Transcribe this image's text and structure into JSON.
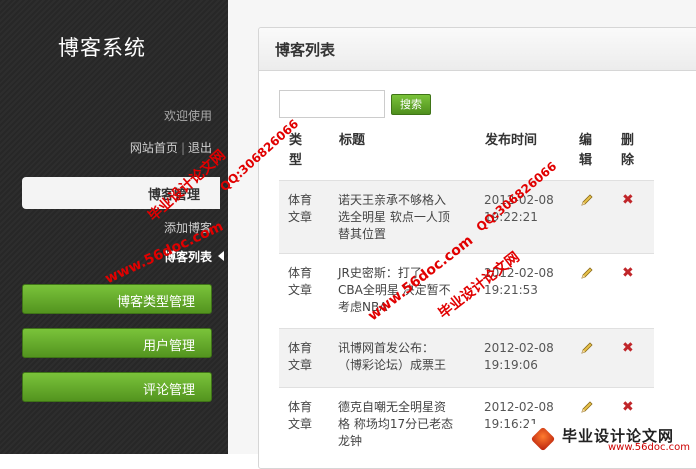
{
  "sidebar": {
    "app_title": "博客系统",
    "welcome": "欢迎使用",
    "links": {
      "home": "网站首页",
      "separator": "|",
      "logout": "退出"
    },
    "active_section": "博客管理",
    "sub_items": [
      "添加博客",
      "博客列表"
    ],
    "nav_buttons": [
      "博客类型管理",
      "用户管理",
      "评论管理"
    ]
  },
  "panel": {
    "title": "博客列表",
    "search_button": "搜索",
    "search_value": "",
    "columns": {
      "type": [
        "类",
        "型"
      ],
      "title": "标题",
      "date": "发布时间",
      "edit": [
        "编",
        "辑"
      ],
      "delete": [
        "删",
        "除"
      ]
    },
    "rows": [
      {
        "type": [
          "体育",
          "文章"
        ],
        "title": [
          "诺天王亲承不够格入",
          "选全明星 软点一人顶",
          "替其位置"
        ],
        "date": [
          "2012-02-08",
          "19:22:21"
        ]
      },
      {
        "type": [
          "体育",
          "文章"
        ],
        "title": [
          "JR史密斯：打了",
          "CBA全明星 决定暂不",
          "考虑NBA"
        ],
        "date": [
          "2012-02-08",
          "19:21:53"
        ]
      },
      {
        "type": [
          "体育",
          "文章"
        ],
        "title": [
          "讯博网首发公布：",
          "（博彩论坛）成票王"
        ],
        "date": [
          "2012-02-08",
          "19:19:06"
        ]
      },
      {
        "type": [
          "体育",
          "文章"
        ],
        "title": [
          "德克自嘲无全明星资",
          "格 称场均17分已老态",
          "龙钟"
        ],
        "date": [
          "2012-02-08",
          "19:16:21"
        ]
      }
    ]
  },
  "watermark": {
    "cn": "毕业设计论文网",
    "qq": "QQ:306826066",
    "url": "www.56doc.com",
    "logo_text": "毕业设计论文网",
    "logo_url": "www.56doc.com"
  },
  "colors": {
    "accent_green": "#5fa82a",
    "delete_red": "#c0262a",
    "sidebar_bg": "#2a2a2a"
  },
  "icons": {
    "edit": "pencil-icon",
    "delete": "x-icon",
    "active_marker": "triangle-pointer-icon"
  }
}
